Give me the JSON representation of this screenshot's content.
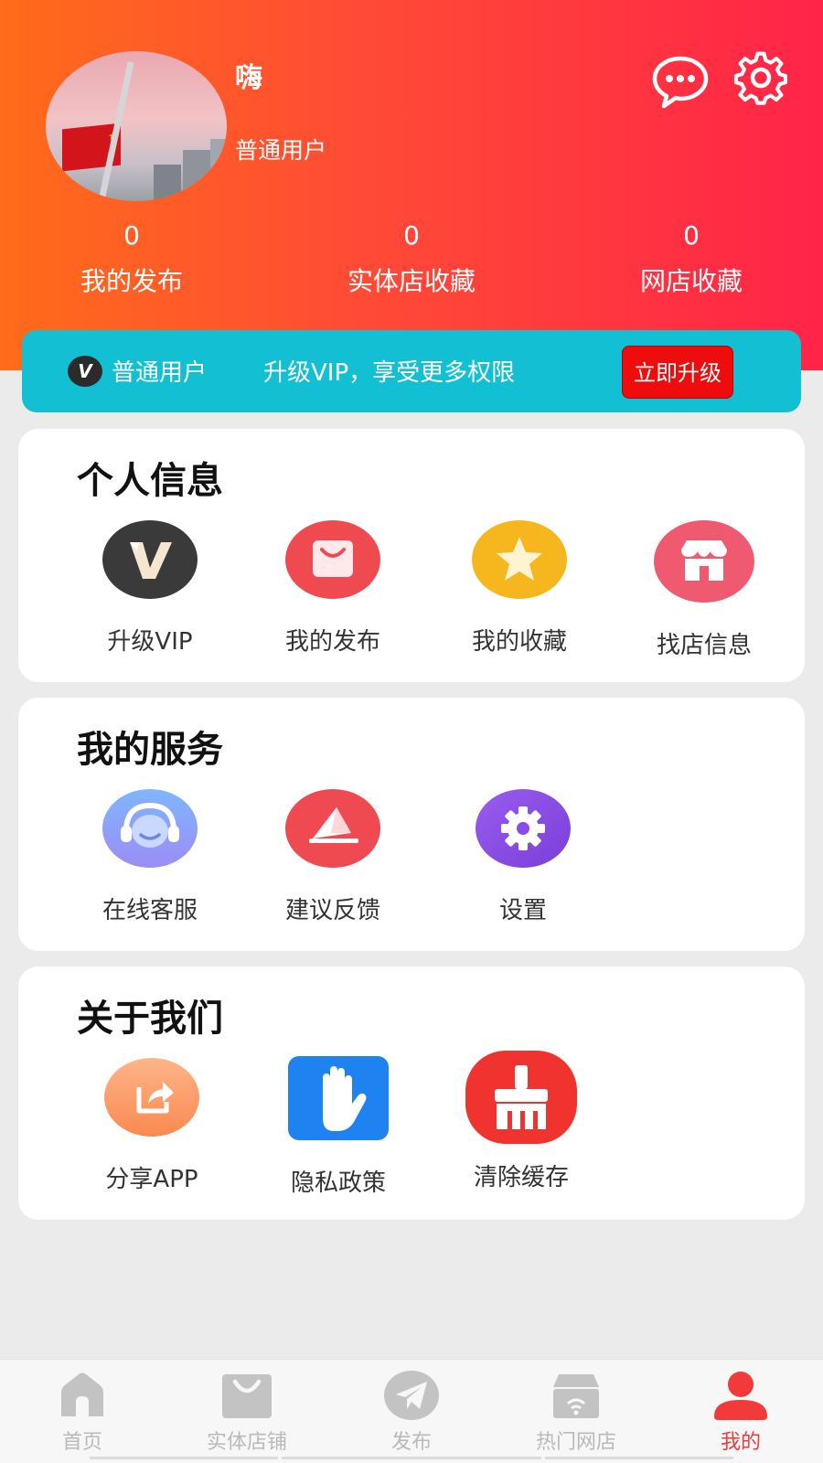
{
  "profile": {
    "name": "嗨",
    "level": "普通用户"
  },
  "stats": [
    {
      "value": "0",
      "label": "我的发布"
    },
    {
      "value": "0",
      "label": "实体店收藏"
    },
    {
      "value": "0",
      "label": "网店收藏"
    }
  ],
  "vip_bar": {
    "badge": "V",
    "level": "普通用户",
    "description": "升级VIP，享受更多权限",
    "button": "立即升级"
  },
  "personal_info": {
    "title": "个人信息",
    "items": [
      {
        "label": "升级VIP",
        "icon": "vip-icon"
      },
      {
        "label": "我的发布",
        "icon": "shopping-bag-icon"
      },
      {
        "label": "我的收藏",
        "icon": "star-icon"
      },
      {
        "label": "找店信息",
        "icon": "storefront-icon"
      }
    ]
  },
  "services": {
    "title": "我的服务",
    "items": [
      {
        "label": "在线客服",
        "icon": "headset-icon"
      },
      {
        "label": "建议反馈",
        "icon": "feedback-icon"
      },
      {
        "label": "设置",
        "icon": "gear-icon"
      }
    ]
  },
  "about": {
    "title": "关于我们",
    "items": [
      {
        "label": "分享APP",
        "icon": "share-icon"
      },
      {
        "label": "隐私政策",
        "icon": "hand-icon"
      },
      {
        "label": "清除缓存",
        "icon": "broom-icon"
      }
    ]
  },
  "nav": {
    "items": [
      {
        "label": "首页",
        "icon": "home-icon",
        "active": false
      },
      {
        "label": "实体店铺",
        "icon": "shopping-bag-icon",
        "active": false
      },
      {
        "label": "发布",
        "icon": "paper-plane-icon",
        "active": false
      },
      {
        "label": "热门网店",
        "icon": "online-store-icon",
        "active": false
      },
      {
        "label": "我的",
        "icon": "user-icon",
        "active": true
      }
    ]
  },
  "colors": {
    "header_start": "#ff6b1a",
    "header_end": "#ff2448",
    "vip_bar": "#12bfd3",
    "upgrade_button": "#ee0c0c",
    "nav_active": "#f23a3a",
    "nav_inactive": "#b9b9b9"
  }
}
